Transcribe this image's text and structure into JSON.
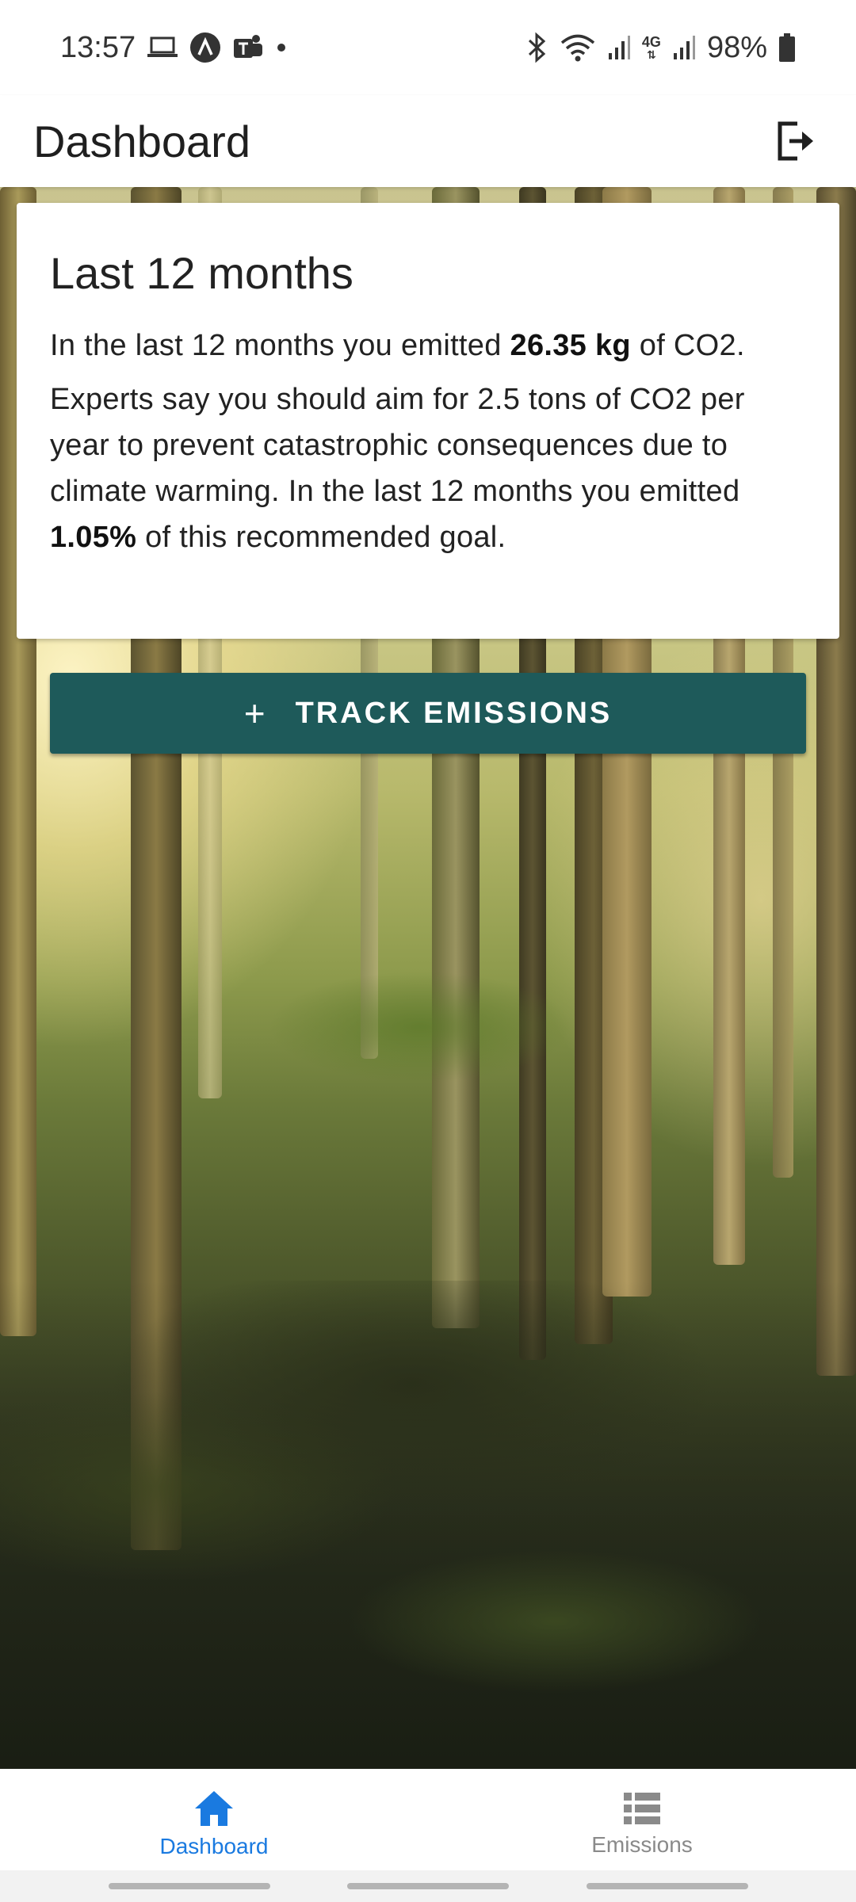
{
  "status_bar": {
    "time": "13:57",
    "battery": "98%",
    "network_label": "4G"
  },
  "app_bar": {
    "title": "Dashboard"
  },
  "card": {
    "title": "Last 12 months",
    "p1_prefix": "In the last 12 months you emitted ",
    "p1_value": "26.35 kg",
    "p1_suffix": " of CO2.",
    "p2_prefix": "Experts say you should aim for 2.5 tons of CO2 per year to prevent catastrophic consequences due to climate warming. In the last 12 months you emitted ",
    "p2_value": "1.05%",
    "p2_suffix": " of this recommended goal."
  },
  "track_button": {
    "icon": "+",
    "label": "TRACK EMISSIONS"
  },
  "bottom_nav": {
    "items": [
      {
        "label": "Dashboard",
        "icon": "home-icon",
        "active": true
      },
      {
        "label": "Emissions",
        "icon": "list-icon",
        "active": false
      }
    ]
  },
  "colors": {
    "primary": "#1e5a5a",
    "nav_active": "#1a7ae0",
    "nav_inactive": "#8a8a8a"
  }
}
